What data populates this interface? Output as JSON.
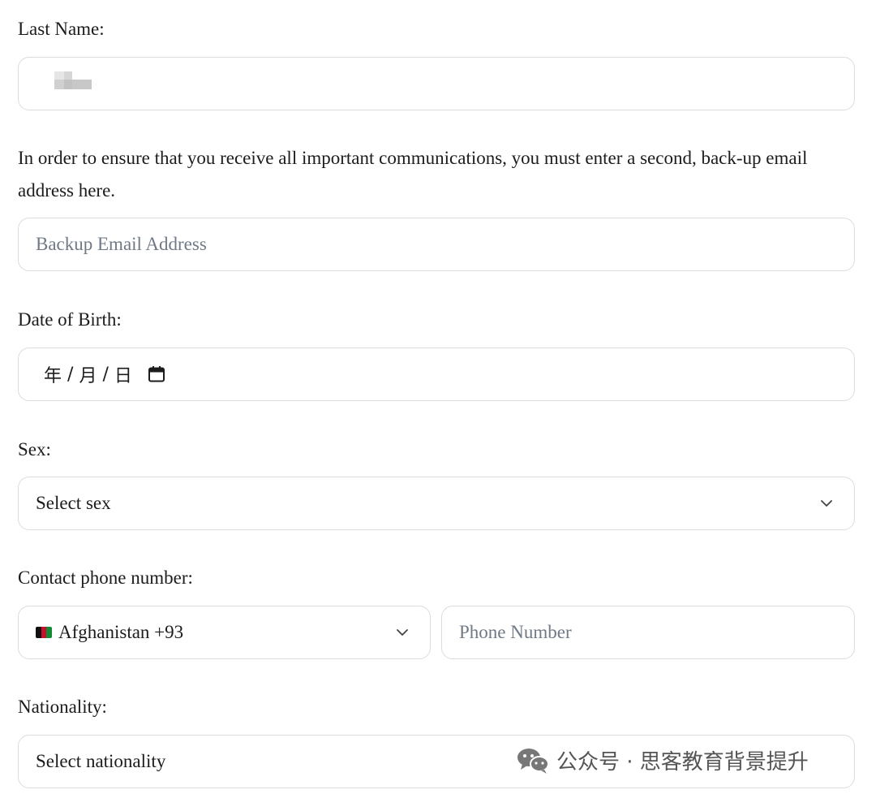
{
  "form": {
    "last_name_label": "Last Name:",
    "backup_email_note": "In order to ensure that you receive all important communications, you must enter a second, back-up email address here.",
    "backup_email_placeholder": "Backup Email Address",
    "dob_label": "Date of Birth:",
    "dob_year": "年",
    "dob_month": "月",
    "dob_day": "日",
    "dob_sep": "/",
    "sex_label": "Sex:",
    "sex_selected": "Select sex",
    "phone_label": "Contact phone number:",
    "phone_country_selected": "Afghanistan +93",
    "phone_placeholder": "Phone Number",
    "nationality_label": "Nationality:",
    "nationality_selected": "Select nationality"
  },
  "icons": {
    "calendar": "calendar-icon",
    "chevron": "chevron-down-icon",
    "flag": "afghanistan-flag-icon",
    "watermark_logo": "wechat-icon"
  },
  "watermark": {
    "text": "公众号 · 思客教育背景提升"
  },
  "colors": {
    "border": "#dcdcdc",
    "placeholder": "#707a87",
    "text": "#1c1c1c"
  }
}
